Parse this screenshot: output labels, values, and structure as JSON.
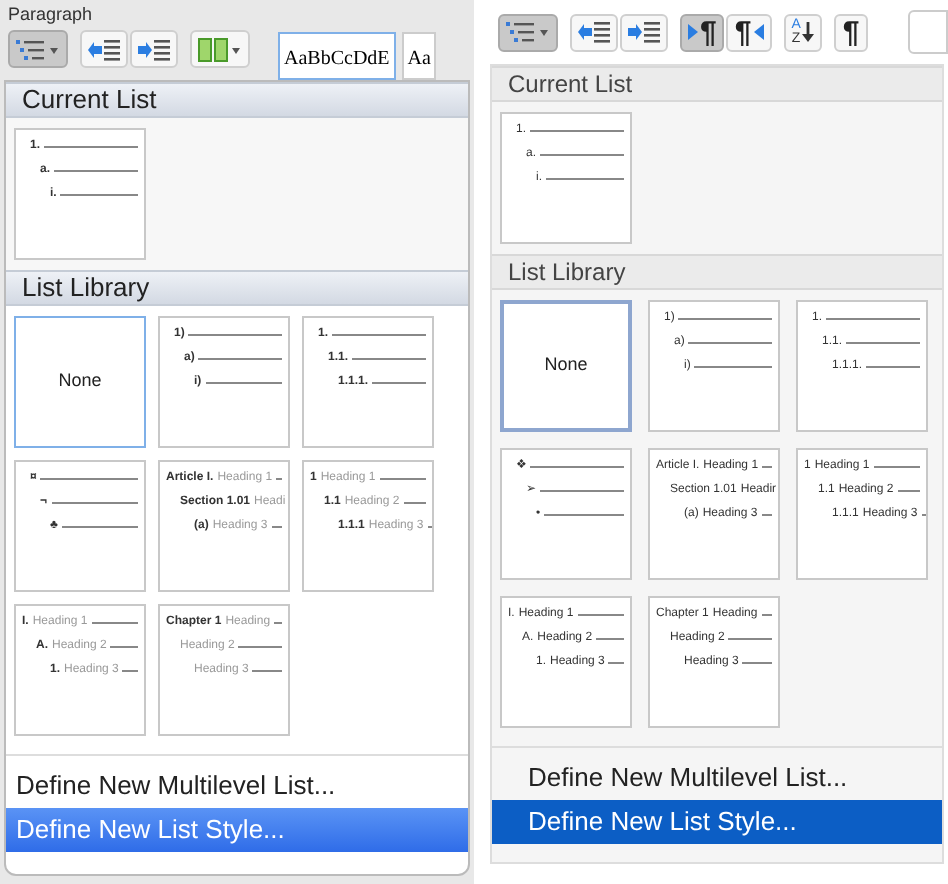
{
  "panels": [
    {
      "kind": "classic",
      "toolbar": {
        "group_label": "Paragraph",
        "buttons": [
          {
            "kind": "multilevel",
            "pressed": true
          },
          {
            "kind": "outdent",
            "pressed": false
          },
          {
            "kind": "indent",
            "pressed": false
          },
          {
            "kind": "columns",
            "pressed": false
          }
        ],
        "style_previews": [
          "AaBbCcDdE",
          "Aa"
        ]
      },
      "current_list": {
        "heading": "Current List",
        "tile": {
          "kind": "list",
          "lines": [
            {
              "marker": "1."
            },
            {
              "marker": "a."
            },
            {
              "marker": "i."
            }
          ]
        }
      },
      "library": {
        "heading": "List Library",
        "tiles": [
          {
            "kind": "none",
            "label": "None",
            "selected": true
          },
          {
            "kind": "list",
            "selected": false,
            "lines": [
              {
                "marker": "1)"
              },
              {
                "marker": "a)"
              },
              {
                "marker": "i)"
              }
            ]
          },
          {
            "kind": "list",
            "selected": false,
            "lines": [
              {
                "marker": "1."
              },
              {
                "marker": "1.1."
              },
              {
                "marker": "1.1.1."
              }
            ]
          },
          {
            "kind": "list",
            "selected": false,
            "lines": [
              {
                "marker": "¤"
              },
              {
                "marker": "¬"
              },
              {
                "marker": "♣"
              }
            ]
          },
          {
            "kind": "list",
            "selected": false,
            "lines": [
              {
                "marker": "Article I.",
                "text": "Heading 1"
              },
              {
                "marker": "Section 1.01",
                "text": "Headi"
              },
              {
                "marker": "(a)",
                "text": "Heading 3"
              }
            ]
          },
          {
            "kind": "list",
            "selected": false,
            "lines": [
              {
                "marker": "1",
                "text": "Heading 1"
              },
              {
                "marker": "1.1",
                "text": "Heading 2"
              },
              {
                "marker": "1.1.1",
                "text": "Heading 3"
              }
            ]
          },
          {
            "kind": "list",
            "selected": false,
            "lines": [
              {
                "marker": "I.",
                "text": "Heading 1"
              },
              {
                "marker": "A.",
                "text": "Heading 2"
              },
              {
                "marker": "1.",
                "text": "Heading 3"
              }
            ]
          },
          {
            "kind": "list",
            "selected": false,
            "lines": [
              {
                "marker": "Chapter 1",
                "text": "Heading"
              },
              {
                "text": "Heading 2"
              },
              {
                "text": "Heading 3"
              }
            ]
          }
        ]
      },
      "menu_items": [
        {
          "label": "Define New Multilevel List...",
          "selected": false
        },
        {
          "label": "Define New List Style...",
          "selected": true
        }
      ]
    },
    {
      "kind": "flat",
      "toolbar": {
        "buttons": [
          {
            "kind": "multilevel",
            "pressed": true
          },
          {
            "kind": "outdent",
            "pressed": false
          },
          {
            "kind": "indent",
            "pressed": false
          },
          {
            "kind": "ltr",
            "pressed": true,
            "symbol": "¶"
          },
          {
            "kind": "rtl",
            "pressed": false,
            "symbol": "¶"
          },
          {
            "kind": "sort",
            "pressed": false,
            "symbol": "A",
            "symbol_2": "Z"
          },
          {
            "kind": "marks",
            "pressed": false,
            "symbol": "¶"
          }
        ]
      },
      "current_list": {
        "heading": "Current List",
        "tile": {
          "kind": "list",
          "lines": [
            {
              "marker": "1."
            },
            {
              "marker": "a."
            },
            {
              "marker": "i."
            }
          ]
        }
      },
      "library": {
        "heading": "List Library",
        "tiles": [
          {
            "kind": "none",
            "label": "None",
            "selected": true
          },
          {
            "kind": "list",
            "selected": false,
            "lines": [
              {
                "marker": "1)"
              },
              {
                "marker": "a)"
              },
              {
                "marker": "i)"
              }
            ]
          },
          {
            "kind": "list",
            "selected": false,
            "lines": [
              {
                "marker": "1."
              },
              {
                "marker": "1.1."
              },
              {
                "marker": "1.1.1."
              }
            ]
          },
          {
            "kind": "list",
            "selected": false,
            "lines": [
              {
                "marker": "❖"
              },
              {
                "marker": "➢"
              },
              {
                "marker": "•"
              }
            ]
          },
          {
            "kind": "list",
            "selected": false,
            "lines": [
              {
                "marker": "Article I.",
                "text": "Heading 1"
              },
              {
                "marker": "Section 1.01",
                "text": "Headir"
              },
              {
                "marker": "(a)",
                "text": "Heading 3"
              }
            ]
          },
          {
            "kind": "list",
            "selected": false,
            "lines": [
              {
                "marker": "1",
                "text": "Heading 1"
              },
              {
                "marker": "1.1",
                "text": "Heading 2"
              },
              {
                "marker": "1.1.1",
                "text": "Heading 3"
              }
            ]
          },
          {
            "kind": "list",
            "selected": false,
            "lines": [
              {
                "marker": "I.",
                "text": "Heading 1"
              },
              {
                "marker": "A.",
                "text": "Heading 2"
              },
              {
                "marker": "1.",
                "text": "Heading 3"
              }
            ]
          },
          {
            "kind": "list",
            "selected": false,
            "lines": [
              {
                "marker": "Chapter 1",
                "text": "Heading"
              },
              {
                "text": "Heading 2"
              },
              {
                "text": "Heading 3"
              }
            ]
          }
        ]
      },
      "menu_items": [
        {
          "label": "Define New Multilevel List...",
          "selected": false
        },
        {
          "label": "Define New List Style...",
          "selected": true
        }
      ]
    }
  ]
}
